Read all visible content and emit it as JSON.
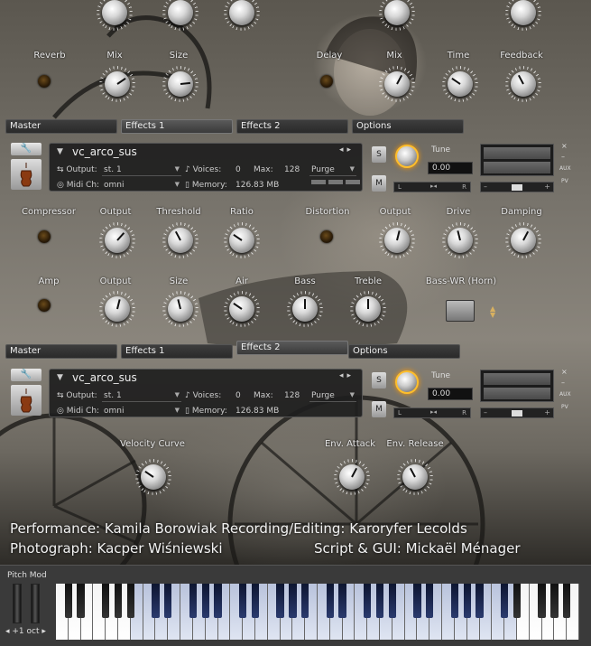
{
  "top_row": {
    "knobs": [
      {
        "label": "Mix",
        "value": 0.7
      },
      {
        "label": "Size",
        "value": 0.8
      },
      {
        "label": "Mix",
        "value": 0.6
      },
      {
        "label": "Time",
        "value": 0.3
      },
      {
        "label": "Feedback",
        "value": 0.4
      }
    ],
    "reverb_label": "Reverb",
    "delay_label": "Delay"
  },
  "tabs1": [
    "Master",
    "Effects 1",
    "Effects 2",
    "Options"
  ],
  "tabs1_active": 1,
  "instrument1": {
    "wrench": "🔧",
    "name": "vc_arco_sus",
    "output_label": "Output:",
    "output_value": "st. 1",
    "voices_label": "Voices:",
    "voices_value": "0",
    "max_label": "Max:",
    "max_value": "128",
    "purge_label": "Purge",
    "midi_label": "Midi Ch:",
    "midi_value": "omni",
    "memory_label": "Memory:",
    "memory_value": "126.83 MB",
    "s_label": "S",
    "m_label": "M",
    "tune_label": "Tune",
    "tune_value": "0.00",
    "pan_left": "L",
    "pan_right": "R",
    "aux_label": "AUX",
    "pv_label": "PV",
    "close": "×",
    "minimize": "–"
  },
  "effects_row1": {
    "labels": [
      "Compressor",
      "Output",
      "Threshold",
      "Ratio",
      "Distortion",
      "Output",
      "Drive",
      "Damping"
    ],
    "knobs": [
      0.65,
      0.4,
      0.3,
      0.55,
      0.45,
      0.6
    ]
  },
  "effects_row2": {
    "labels": [
      "Amp",
      "Output",
      "Size",
      "Air",
      "Bass",
      "Treble",
      "Bass-WR (Horn)"
    ],
    "knobs": [
      0.55,
      0.45,
      0.3,
      0.5,
      0.5
    ]
  },
  "tabs2": [
    "Master",
    "Effects 1",
    "Effects 2",
    "Options"
  ],
  "tabs2_active": 2,
  "instrument2": {
    "name": "vc_arco_sus",
    "output_value": "st. 1",
    "voices_value": "0",
    "max_value": "128",
    "midi_value": "omni",
    "memory_value": "126.83 MB",
    "tune_value": "0.00"
  },
  "envelope": {
    "labels": [
      "Velocity Curve",
      "Env. Attack",
      "Env. Release"
    ],
    "knobs": [
      0.3,
      0.6,
      0.4
    ]
  },
  "credits": {
    "line1": "Performance: Kamila Borowiak Recording/Editing: Karoryfer Lecolds",
    "line2a": "Photograph: Kacper Wiśniewski",
    "line2b": "Script & GUI: Mickaël Ménager"
  },
  "bottom": {
    "pitch_mod": "Pitch Mod",
    "octave": "◂ +1 oct ▸"
  },
  "colors": {
    "tune_glow": "#ffbe2a",
    "key_blue": "#b9c3dc",
    "key_dark_blue": "#2a3a6e"
  }
}
